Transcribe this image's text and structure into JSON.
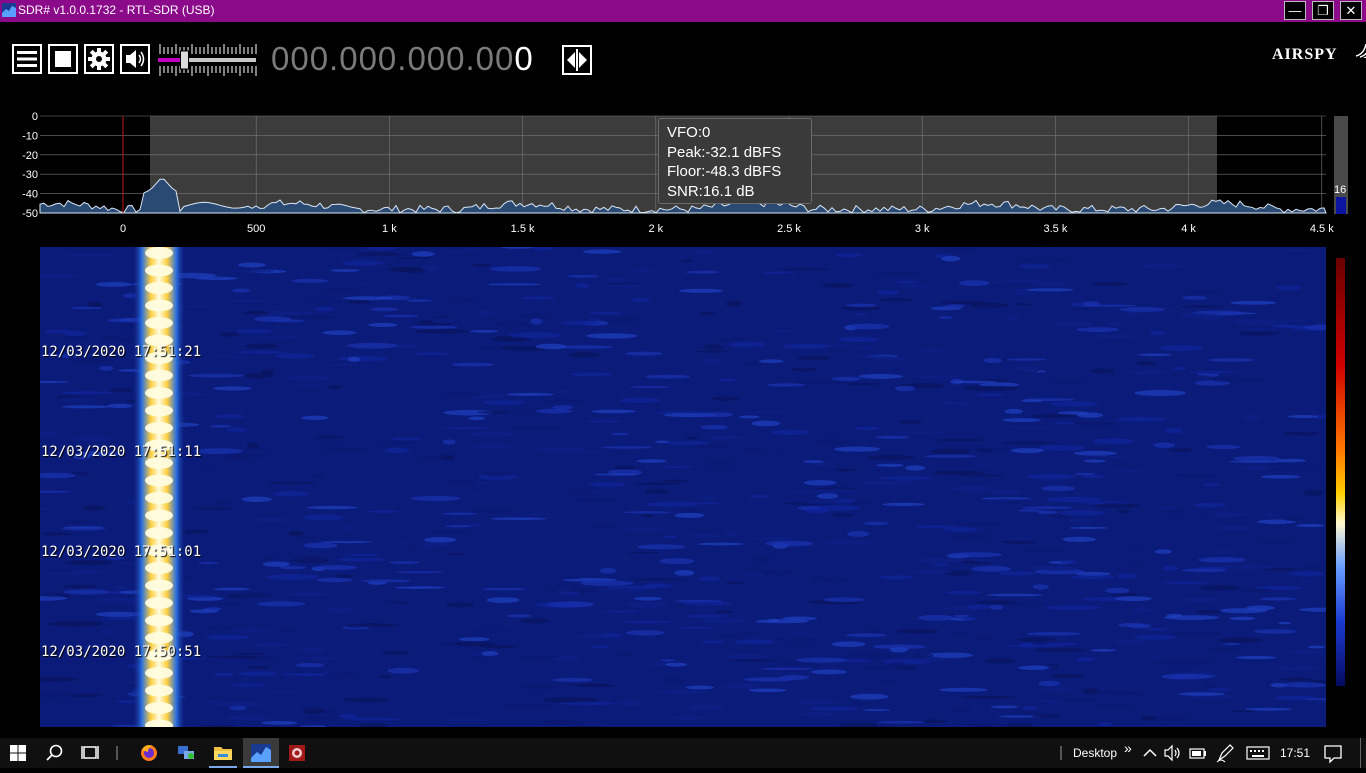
{
  "window": {
    "title": "SDR# v1.0.0.1732 - RTL-SDR (USB)",
    "controls": [
      "minimize",
      "restore",
      "close"
    ],
    "controls_glyphs": {
      "minimize": "—",
      "restore": "❐",
      "close": "✕"
    }
  },
  "toolbar": {
    "icons": [
      "menu-icon",
      "stop-icon",
      "gear-icon",
      "speaker-icon"
    ],
    "volume_level": 0.25,
    "frequency": {
      "dim": "000.000.000.00",
      "bright": "0"
    },
    "logo": "AIRSPY"
  },
  "spectrum": {
    "y_ticks": [
      "0",
      "-10",
      "-20",
      "-30",
      "-40",
      "-50"
    ],
    "x_ticks": [
      "0",
      "500",
      "1 k",
      "1.5 k",
      "2 k",
      "2.5 k",
      "3 k",
      "3.5 k",
      "4 k",
      "4.5 k"
    ],
    "tooltip": {
      "vfo": "VFO:0",
      "peak": "Peak:-32.1 dBFS",
      "floor": "Floor:-48.3 dBFS",
      "snr": "SNR:16.1 dB"
    },
    "gain_value": "16",
    "colors": {
      "filter_band": "#3c3c3c",
      "vfo_line": "#c01818",
      "trace_fill": "#2b4a73",
      "trace_line": "#d9e6f5"
    }
  },
  "waterfall": {
    "timestamps": [
      "12/03/2020 17:51:21",
      "12/03/2020 17:51:11",
      "12/03/2020 17:51:01",
      "12/03/2020 17:50:51"
    ],
    "colors": {
      "background": "#0b1b7a",
      "signal": "#fff3a0"
    }
  },
  "taskbar": {
    "icons": [
      "windows-start-icon",
      "search-icon",
      "task-view-icon",
      "firefox-icon",
      "network-app-icon",
      "file-explorer-icon",
      "sdr-app-icon",
      "red-app-icon"
    ],
    "desktop_label": "Desktop",
    "chevron": "»",
    "clock": "17:51"
  }
}
